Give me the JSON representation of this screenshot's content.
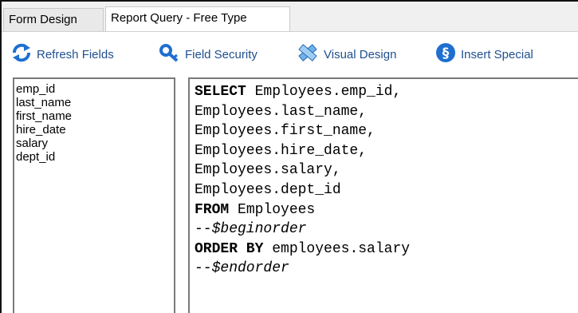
{
  "tabs": [
    {
      "label": "Form Design"
    },
    {
      "label": "Report Query - Free Type"
    }
  ],
  "toolbar": {
    "refresh": {
      "label": "Refresh Fields",
      "icon": "refresh-icon"
    },
    "security": {
      "label": "Field Security",
      "icon": "key-icon"
    },
    "visual": {
      "label": "Visual Design",
      "icon": "design-tool-icon"
    },
    "insert": {
      "label": "Insert Special",
      "icon": "section-sign-icon"
    }
  },
  "fields": [
    "emp_id",
    "last_name",
    "first_name",
    "hire_date",
    "salary",
    "dept_id"
  ],
  "sql": {
    "l1_kw": "SELECT",
    "l1_rest": " Employees.emp_id,",
    "l2": "Employees.last_name,",
    "l3": "Employees.first_name,",
    "l4": "Employees.hire_date,",
    "l5": "Employees.salary,",
    "l6": "Employees.dept_id",
    "l7_kw": "FROM",
    "l7_rest": " Employees",
    "l8": "--$beginorder",
    "l9_kw": "ORDER BY",
    "l9_rest": " employees.salary",
    "l10": "--$endorder"
  },
  "colors": {
    "toolbar_text": "#1f4f8f",
    "icon_blue": "#1e6fd0"
  }
}
